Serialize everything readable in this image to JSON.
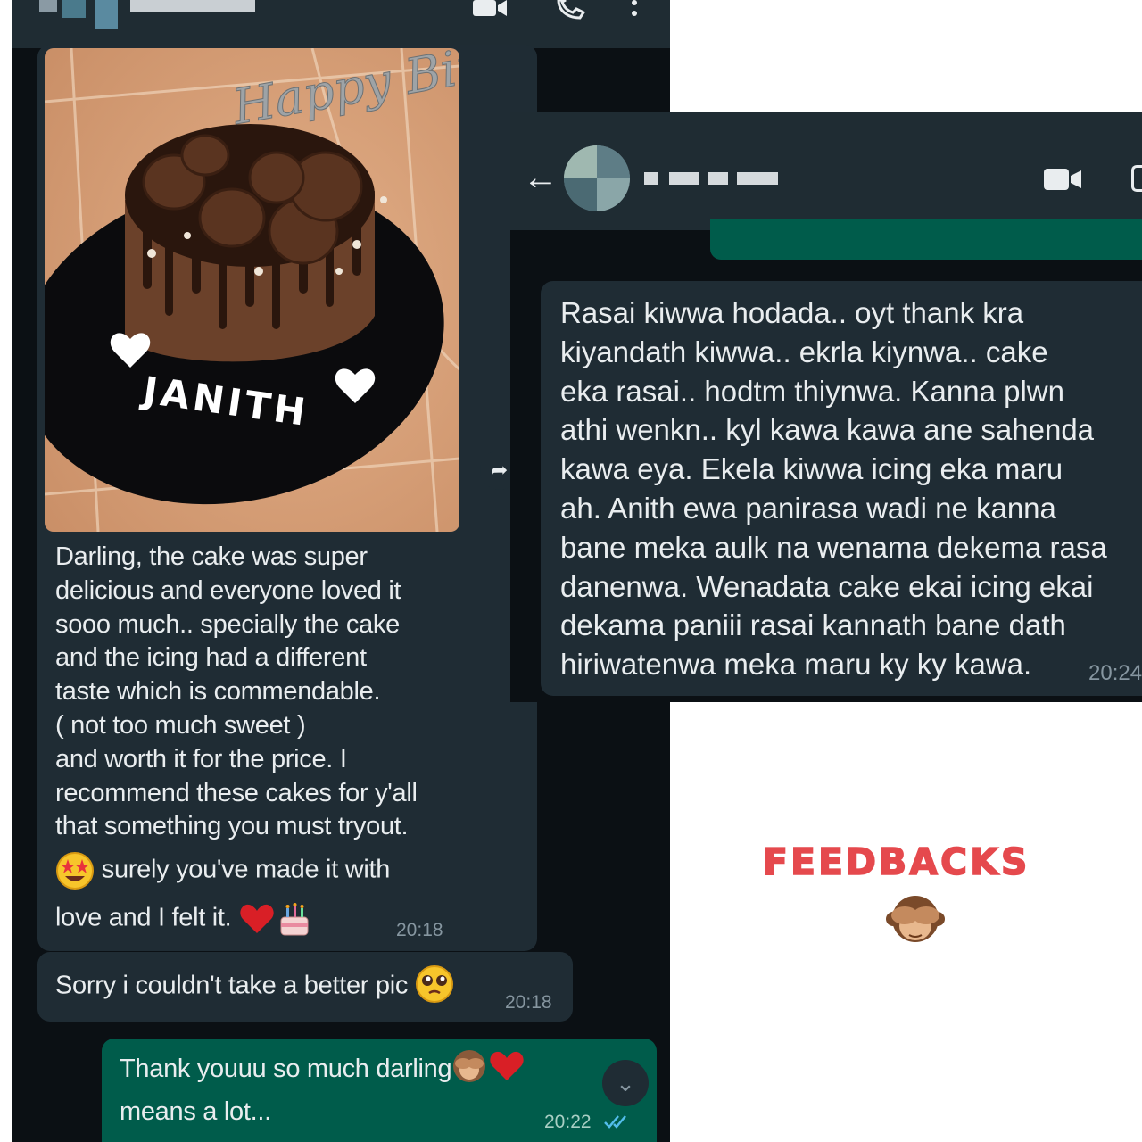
{
  "title": "FEEDBACKS",
  "colors": {
    "chat_background": "#0b1014",
    "header": "#1f2c33",
    "incoming_bubble": "#1f2c34",
    "outgoing_bubble": "#005c4b",
    "text": "#e9edef",
    "timestamp": "#8696a0",
    "title_red": "#e5494d"
  },
  "chat_left": {
    "header_icons": [
      "video-call-icon",
      "phone-icon",
      "more-options-icon"
    ],
    "photo_message": {
      "cake_topper_text": "Happy Birthday",
      "cake_name": "JANITH",
      "caption_lines": [
        "Darling, the cake was super",
        "delicious and everyone loved it",
        "sooo much.. specially the cake",
        "and the icing had a different",
        "taste which is commendable.",
        "( not too much sweet )",
        "and worth it for the price. I",
        "recommend these cakes for y'all",
        "that something you must tryout."
      ],
      "caption_emoji_line": "surely you've made it with",
      "caption_last_line": "love and I felt it.",
      "time": "20:18"
    },
    "message_2": {
      "text": "Sorry i couldn't take a better pic",
      "time": "20:18"
    },
    "message_3": {
      "line_1": "Thank youuu so much darling",
      "line_2": "means a lot...",
      "time": "20:22",
      "status": "read-double-check-icon"
    }
  },
  "chat_right": {
    "header_icons": [
      "back-arrow-icon",
      "video-call-icon"
    ],
    "message": {
      "lines": [
        "Rasai kiwwa hodada.. oyt thank kra",
        "kiyandath kiwwa.. ekrla kiynwa.. cake",
        "eka rasai.. hodtm thiynwa. Kanna plwn",
        "athi wenkn.. kyl kawa kawa ane sahenda",
        "kawa eya. Ekela kiwwa icing eka maru",
        "ah. Anith ewa panirasa wadi ne kanna",
        "bane meka aulk na wenama dekema rasa",
        "danenwa. Wenadata cake ekai icing ekai",
        "dekama paniii rasai kannath bane dath",
        "hiriwatenwa meka maru ky ky kawa."
      ],
      "time": "20:24"
    }
  }
}
